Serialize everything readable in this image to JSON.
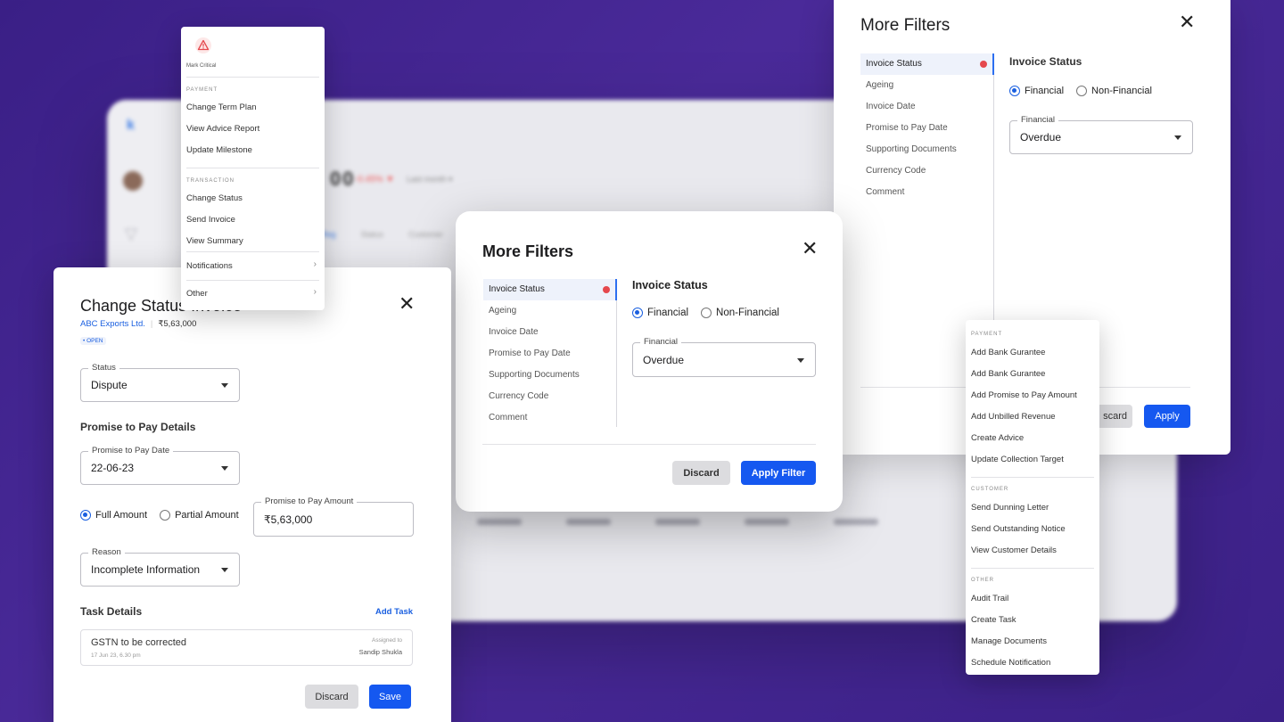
{
  "background": {
    "logo_letter": "k",
    "header_amount": "00",
    "header_change": "-0.45% ▼",
    "header_period": "Last month ▾",
    "tabs": [
      "Reg",
      "Status",
      "Customer"
    ]
  },
  "left_menu": {
    "critical_icon": "warning-triangle-icon",
    "critical_label": "Mark Critical",
    "payment_head": "PAYMENT",
    "payment_items": [
      "Change Term Plan",
      "View Advice Report",
      "Update Milestone"
    ],
    "transaction_head": "TRANSACTION",
    "transaction_items": [
      "Change Status",
      "Send Invoice",
      "View Summary"
    ],
    "notifications_label": "Notifications",
    "other_label": "Other"
  },
  "right_filters": {
    "title": "More Filters",
    "side_items": [
      "Invoice Status",
      "Ageing",
      "Invoice Date",
      "Promise to Pay Date",
      "Supporting Documents",
      "Currency Code",
      "Comment"
    ],
    "section_title": "Invoice Status",
    "radio_financial": "Financial",
    "radio_nonfinancial": "Non-Financial",
    "select_label": "Financial",
    "select_value": "Overdue",
    "discard_label": "scard",
    "apply_label": "Apply"
  },
  "center_filters": {
    "title": "More Filters",
    "side_items": [
      "Invoice Status",
      "Ageing",
      "Invoice Date",
      "Promise to Pay Date",
      "Supporting Documents",
      "Currency Code",
      "Comment"
    ],
    "section_title": "Invoice Status",
    "radio_financial": "Financial",
    "radio_nonfinancial": "Non-Financial",
    "select_label": "Financial",
    "select_value": "Overdue",
    "discard_label": "Discard",
    "apply_label": "Apply Filter"
  },
  "change_status": {
    "title": "Change Status Invoice",
    "company": "ABC Exports Ltd.",
    "amount": "₹5,63,000",
    "badge": "• OPEN",
    "status_label": "Status",
    "status_value": "Dispute",
    "ptp_section": "Promise to Pay Details",
    "ptp_date_label": "Promise to Pay Date",
    "ptp_date_value": "22-06-23",
    "radio_full": "Full Amount",
    "radio_partial": "Partial Amount",
    "ptp_amount_label": "Promise to Pay Amount",
    "ptp_amount_value": "₹5,63,000",
    "reason_label": "Reason",
    "reason_value": "Incomplete Information",
    "task_section": "Task Details",
    "add_task": "Add Task",
    "task_title": "GSTN to be corrected",
    "task_date": "17 Jun 23, 6.30 pm",
    "assigned_label": "Assigned to",
    "assigned_name": "Sandip Shukla",
    "discard_label": "Discard",
    "save_label": "Save"
  },
  "right_menu": {
    "payment_head": "PAYMENT",
    "payment_items": [
      "Add Bank Gurantee",
      "Add Bank Gurantee",
      "Add Promise to Pay Amount",
      "Add Unbilled Revenue",
      "Create Advice",
      "Update Collection Target"
    ],
    "customer_head": "CUSTOMER",
    "customer_items": [
      "Send Dunning Letter",
      "Send Outstanding Notice",
      "View Customer Details"
    ],
    "other_head": "OTHER",
    "other_items": [
      "Audit Trail",
      "Create Task",
      "Manage Documents",
      "Schedule Notification"
    ]
  },
  "colors": {
    "background": "#3c2188",
    "primary": "#1558f0",
    "alert": "#e5484d"
  }
}
